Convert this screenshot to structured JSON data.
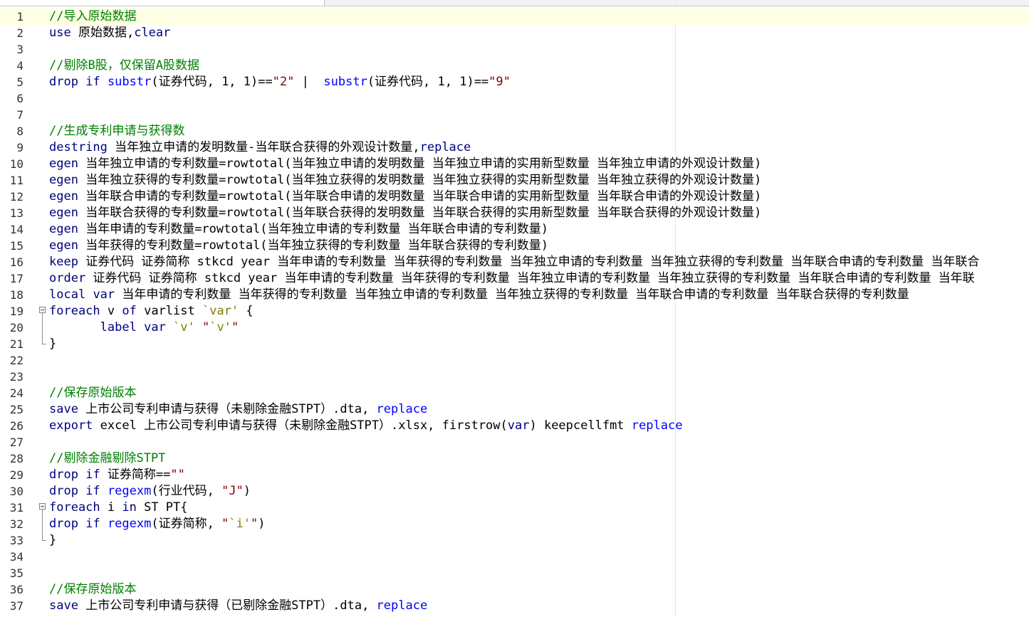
{
  "editor": {
    "current_line": 1,
    "lines": [
      {
        "n": "1",
        "fold": "",
        "tokens": [
          {
            "t": "//导入原始数据",
            "c": "c"
          }
        ]
      },
      {
        "n": "2",
        "fold": "",
        "tokens": [
          {
            "t": "use",
            "c": "k"
          },
          {
            "t": " 原始数据,",
            "c": "p"
          },
          {
            "t": "clear",
            "c": "k"
          }
        ]
      },
      {
        "n": "3",
        "fold": "",
        "tokens": []
      },
      {
        "n": "4",
        "fold": "",
        "tokens": [
          {
            "t": "//剔除B股，仅保留A股数据",
            "c": "c"
          }
        ]
      },
      {
        "n": "5",
        "fold": "",
        "tokens": [
          {
            "t": "drop",
            "c": "k"
          },
          {
            "t": " ",
            "c": "p"
          },
          {
            "t": "if",
            "c": "k"
          },
          {
            "t": " ",
            "c": "p"
          },
          {
            "t": "substr",
            "c": "f"
          },
          {
            "t": "(证券代码, 1, 1)==",
            "c": "p"
          },
          {
            "t": "\"2\"",
            "c": "s"
          },
          {
            "t": " |  ",
            "c": "p"
          },
          {
            "t": "substr",
            "c": "f"
          },
          {
            "t": "(证券代码, 1, 1)==",
            "c": "p"
          },
          {
            "t": "\"9\"",
            "c": "s"
          }
        ]
      },
      {
        "n": "6",
        "fold": "",
        "tokens": []
      },
      {
        "n": "7",
        "fold": "",
        "tokens": []
      },
      {
        "n": "8",
        "fold": "",
        "tokens": [
          {
            "t": "//生成专利申请与获得数",
            "c": "c"
          }
        ]
      },
      {
        "n": "9",
        "fold": "",
        "tokens": [
          {
            "t": "destring",
            "c": "k"
          },
          {
            "t": " 当年独立申请的发明数量-当年联合获得的外观设计数量,",
            "c": "p"
          },
          {
            "t": "replace",
            "c": "k"
          }
        ]
      },
      {
        "n": "10",
        "fold": "",
        "tokens": [
          {
            "t": "egen",
            "c": "k"
          },
          {
            "t": " 当年独立申请的专利数量=rowtotal(当年独立申请的发明数量 当年独立申请的实用新型数量 当年独立申请的外观设计数量)",
            "c": "p"
          }
        ]
      },
      {
        "n": "11",
        "fold": "",
        "tokens": [
          {
            "t": "egen",
            "c": "k"
          },
          {
            "t": " 当年独立获得的专利数量=rowtotal(当年独立获得的发明数量 当年独立获得的实用新型数量 当年独立获得的外观设计数量)",
            "c": "p"
          }
        ]
      },
      {
        "n": "12",
        "fold": "",
        "tokens": [
          {
            "t": "egen",
            "c": "k"
          },
          {
            "t": " 当年联合申请的专利数量=rowtotal(当年联合申请的发明数量 当年联合申请的实用新型数量 当年联合申请的外观设计数量)",
            "c": "p"
          }
        ]
      },
      {
        "n": "13",
        "fold": "",
        "tokens": [
          {
            "t": "egen",
            "c": "k"
          },
          {
            "t": " 当年联合获得的专利数量=rowtotal(当年联合获得的发明数量 当年联合获得的实用新型数量 当年联合获得的外观设计数量)",
            "c": "p"
          }
        ]
      },
      {
        "n": "14",
        "fold": "",
        "tokens": [
          {
            "t": "egen",
            "c": "k"
          },
          {
            "t": " 当年申请的专利数量=rowtotal(当年独立申请的专利数量 当年联合申请的专利数量)",
            "c": "p"
          }
        ]
      },
      {
        "n": "15",
        "fold": "",
        "tokens": [
          {
            "t": "egen",
            "c": "k"
          },
          {
            "t": " 当年获得的专利数量=rowtotal(当年独立获得的专利数量 当年联合获得的专利数量)",
            "c": "p"
          }
        ]
      },
      {
        "n": "16",
        "fold": "",
        "tokens": [
          {
            "t": "keep",
            "c": "k"
          },
          {
            "t": " 证券代码 证券简称 stkcd year 当年申请的专利数量 当年获得的专利数量 当年独立申请的专利数量 当年独立获得的专利数量 当年联合申请的专利数量 当年联合",
            "c": "p"
          }
        ]
      },
      {
        "n": "17",
        "fold": "",
        "tokens": [
          {
            "t": "order",
            "c": "k"
          },
          {
            "t": " 证券代码 证券简称 stkcd year 当年申请的专利数量 当年获得的专利数量 当年独立申请的专利数量 当年独立获得的专利数量 当年联合申请的专利数量 当年联",
            "c": "p"
          }
        ]
      },
      {
        "n": "18",
        "fold": "",
        "tokens": [
          {
            "t": "local",
            "c": "k"
          },
          {
            "t": " ",
            "c": "p"
          },
          {
            "t": "var",
            "c": "k"
          },
          {
            "t": " 当年申请的专利数量 当年获得的专利数量 当年独立申请的专利数量 当年独立获得的专利数量 当年联合申请的专利数量 当年联合获得的专利数量",
            "c": "p"
          }
        ]
      },
      {
        "n": "19",
        "fold": "start",
        "tokens": [
          {
            "t": "foreach",
            "c": "k"
          },
          {
            "t": " v ",
            "c": "p"
          },
          {
            "t": "of",
            "c": "k"
          },
          {
            "t": " varlist ",
            "c": "p"
          },
          {
            "t": "`var'",
            "c": "m"
          },
          {
            "t": " {",
            "c": "p"
          }
        ]
      },
      {
        "n": "20",
        "fold": "mid",
        "tokens": [
          {
            "t": "       ",
            "c": "p"
          },
          {
            "t": "label",
            "c": "k"
          },
          {
            "t": " ",
            "c": "p"
          },
          {
            "t": "var",
            "c": "k"
          },
          {
            "t": " ",
            "c": "p"
          },
          {
            "t": "`v'",
            "c": "m"
          },
          {
            "t": " \"",
            "c": "s"
          },
          {
            "t": "`v'",
            "c": "m"
          },
          {
            "t": "\"",
            "c": "s"
          }
        ]
      },
      {
        "n": "21",
        "fold": "end",
        "tokens": [
          {
            "t": "}",
            "c": "p"
          }
        ]
      },
      {
        "n": "22",
        "fold": "",
        "tokens": []
      },
      {
        "n": "23",
        "fold": "",
        "tokens": []
      },
      {
        "n": "24",
        "fold": "",
        "tokens": [
          {
            "t": "//保存原始版本",
            "c": "c"
          }
        ]
      },
      {
        "n": "25",
        "fold": "",
        "tokens": [
          {
            "t": "save",
            "c": "k"
          },
          {
            "t": " 上市公司专利申请与获得（未剔除金融STPT）.dta, ",
            "c": "p"
          },
          {
            "t": "replace",
            "c": "f"
          }
        ]
      },
      {
        "n": "26",
        "fold": "",
        "tokens": [
          {
            "t": "export",
            "c": "k"
          },
          {
            "t": " excel 上市公司专利申请与获得（未剔除金融STPT）.xlsx, firstrow(",
            "c": "p"
          },
          {
            "t": "var",
            "c": "k"
          },
          {
            "t": ") keepcellfmt ",
            "c": "p"
          },
          {
            "t": "replace",
            "c": "f"
          }
        ]
      },
      {
        "n": "27",
        "fold": "",
        "tokens": []
      },
      {
        "n": "28",
        "fold": "",
        "tokens": [
          {
            "t": "//剔除金融剔除STPT",
            "c": "c"
          }
        ]
      },
      {
        "n": "29",
        "fold": "",
        "tokens": [
          {
            "t": "drop",
            "c": "k"
          },
          {
            "t": " ",
            "c": "p"
          },
          {
            "t": "if",
            "c": "k"
          },
          {
            "t": " 证券简称==",
            "c": "p"
          },
          {
            "t": "\"\"",
            "c": "s"
          }
        ]
      },
      {
        "n": "30",
        "fold": "",
        "tokens": [
          {
            "t": "drop",
            "c": "k"
          },
          {
            "t": " ",
            "c": "p"
          },
          {
            "t": "if",
            "c": "k"
          },
          {
            "t": " ",
            "c": "p"
          },
          {
            "t": "regexm",
            "c": "f"
          },
          {
            "t": "(行业代码, ",
            "c": "p"
          },
          {
            "t": "\"J\"",
            "c": "s"
          },
          {
            "t": ")",
            "c": "p"
          }
        ]
      },
      {
        "n": "31",
        "fold": "start",
        "tokens": [
          {
            "t": "foreach",
            "c": "k"
          },
          {
            "t": " i ",
            "c": "p"
          },
          {
            "t": "in",
            "c": "k"
          },
          {
            "t": " ST PT{",
            "c": "p"
          }
        ]
      },
      {
        "n": "32",
        "fold": "mid",
        "tokens": [
          {
            "t": "drop",
            "c": "k"
          },
          {
            "t": " ",
            "c": "p"
          },
          {
            "t": "if",
            "c": "k"
          },
          {
            "t": " ",
            "c": "p"
          },
          {
            "t": "regexm",
            "c": "f"
          },
          {
            "t": "(证券简称, ",
            "c": "p"
          },
          {
            "t": "\"",
            "c": "s"
          },
          {
            "t": "`i'",
            "c": "m"
          },
          {
            "t": "\"",
            "c": "s"
          },
          {
            "t": ")",
            "c": "p"
          }
        ]
      },
      {
        "n": "33",
        "fold": "end",
        "tokens": [
          {
            "t": "}",
            "c": "p"
          }
        ]
      },
      {
        "n": "34",
        "fold": "",
        "tokens": []
      },
      {
        "n": "35",
        "fold": "",
        "tokens": []
      },
      {
        "n": "36",
        "fold": "",
        "tokens": [
          {
            "t": "//保存原始版本",
            "c": "c"
          }
        ]
      },
      {
        "n": "37",
        "fold": "",
        "tokens": [
          {
            "t": "save",
            "c": "k"
          },
          {
            "t": " 上市公司专利申请与获得（已剔除金融STPT）.dta, ",
            "c": "p"
          },
          {
            "t": "replace",
            "c": "f"
          }
        ]
      }
    ]
  }
}
